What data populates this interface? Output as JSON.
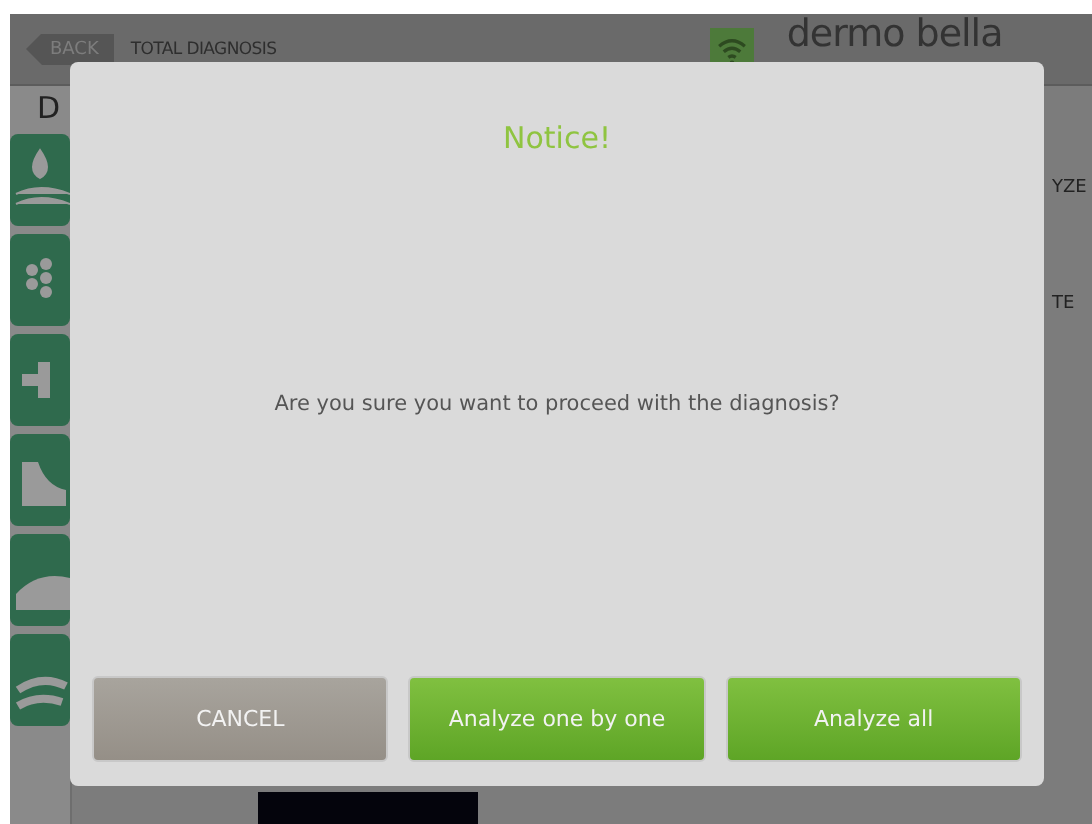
{
  "top_bar": {
    "back_button": "BACK",
    "title": "TOTAL DIAGNOSIS",
    "logo": "dermo bella"
  },
  "background": {
    "heading_fragment": "D",
    "side_labels": [
      "YZE",
      "TE"
    ]
  },
  "dialog": {
    "title": "Notice!",
    "message": "Are you sure you want to proceed with the diagnosis?",
    "buttons": [
      {
        "label": "CANCEL",
        "kind": "cancel"
      },
      {
        "label": "Analyze one by one",
        "kind": "primary"
      },
      {
        "label": "Analyze all",
        "kind": "primary"
      }
    ]
  }
}
